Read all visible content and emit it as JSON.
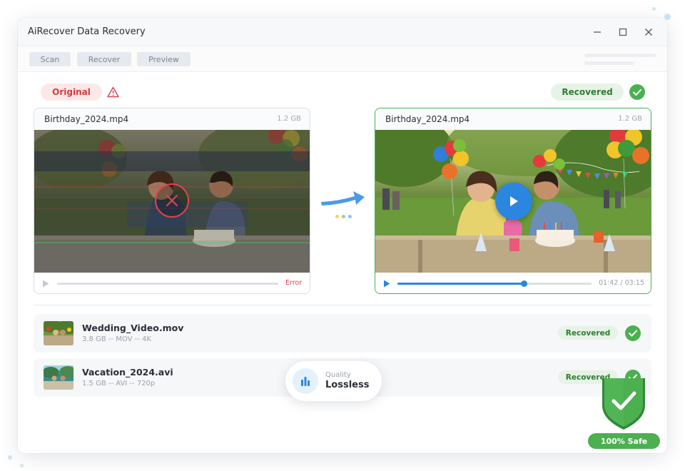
{
  "window": {
    "title": "AiRecover Data Recovery"
  },
  "toolbar": {
    "scan_label": "Scan",
    "recover_label": "Recover",
    "preview_label": "Preview"
  },
  "comparison": {
    "original_label": "Original",
    "recovered_label": "Recovered",
    "original_file": {
      "name": "Birthday_2024.mp4",
      "size": "1.2 GB",
      "status": "Error"
    },
    "recovered_file": {
      "name": "Birthday_2024.mp4",
      "size": "1.2 GB",
      "time": "01:42 / 03:15",
      "progress": 0.65
    }
  },
  "files": [
    {
      "name": "Wedding_Video.mov",
      "meta": "3.8 GB -- MOV -- 4K",
      "status": "Recovered"
    },
    {
      "name": "Vacation_2024.avi",
      "meta": "1.5 GB -- AVI -- 720p",
      "status": "Recovered"
    }
  ],
  "quality": {
    "label": "Quality",
    "value": "Lossless"
  },
  "safety": {
    "label": "100% Safe"
  },
  "colors": {
    "success": "#4caf50",
    "error": "#e0454f",
    "accent": "#2b86e0"
  }
}
